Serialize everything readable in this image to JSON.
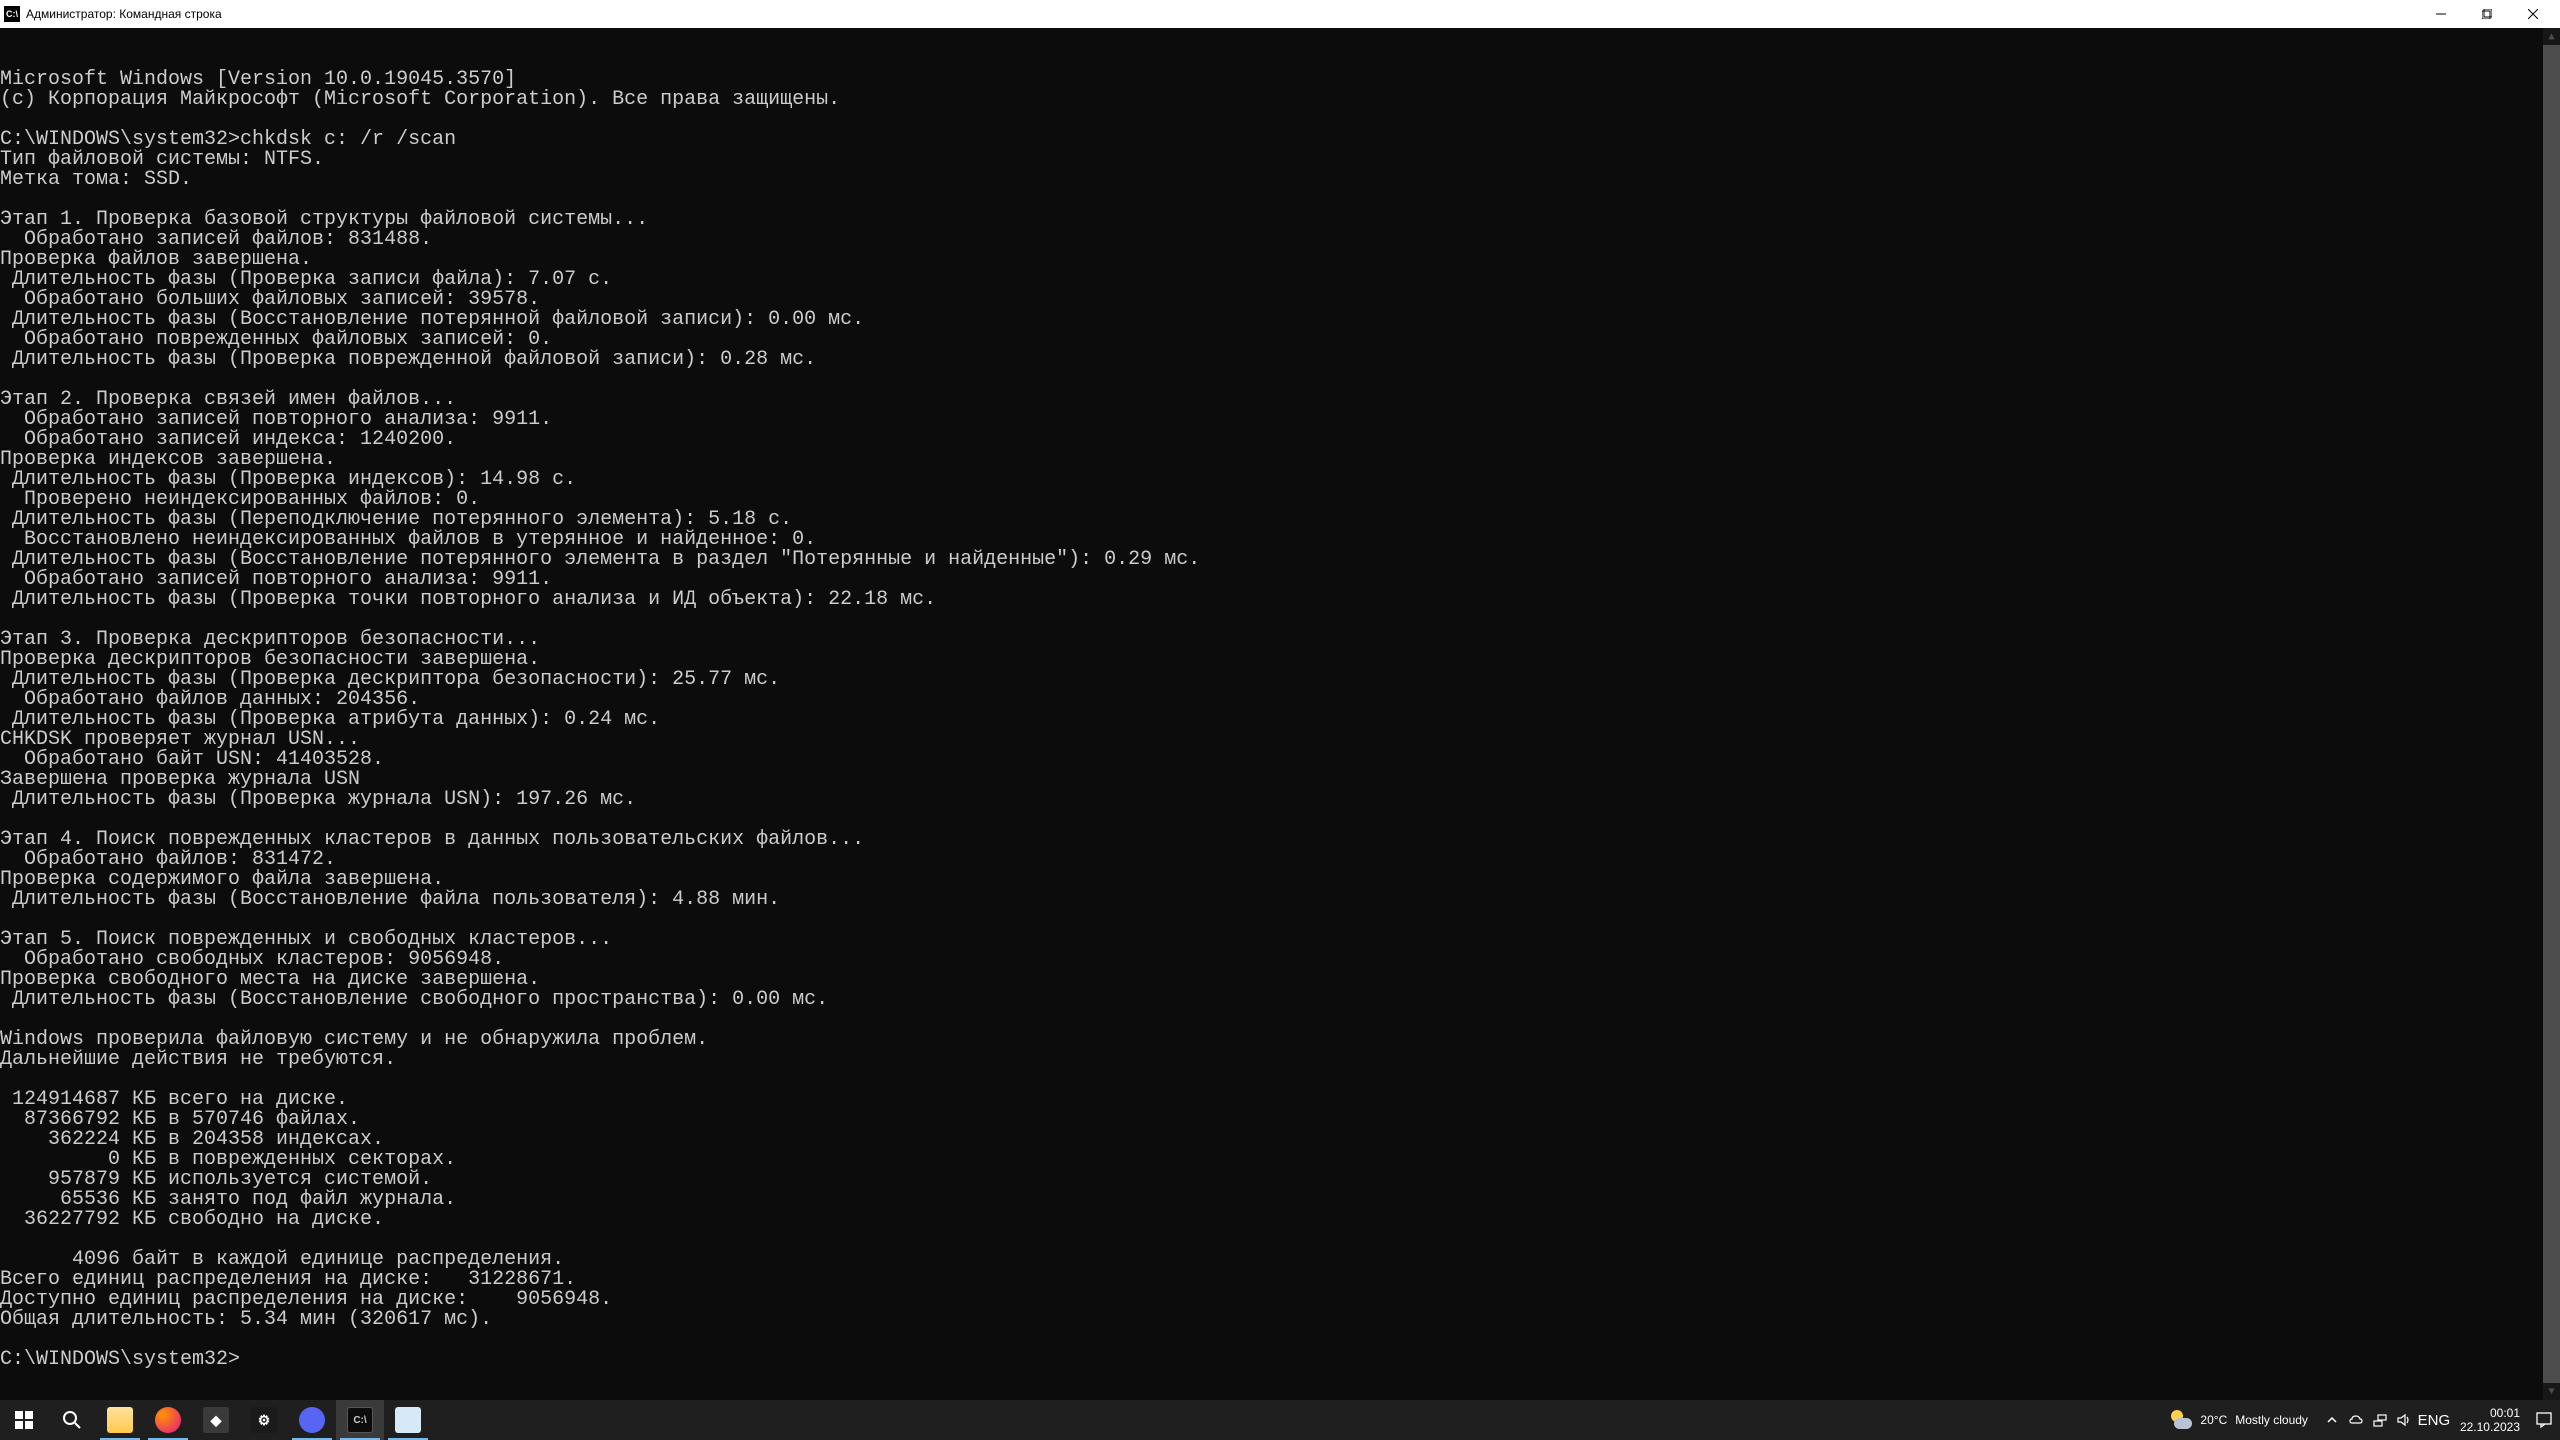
{
  "window": {
    "title": "Администратор: Командная строка"
  },
  "terminal": {
    "lines": "Microsoft Windows [Version 10.0.19045.3570]\n(c) Корпорация Майкрософт (Microsoft Corporation). Все права защищены.\n\nC:\\WINDOWS\\system32>chkdsk c: /r /scan\nТип файловой системы: NTFS.\nМетка тома: SSD.\n\nЭтап 1. Проверка базовой структуры файловой системы...\n  Обработано записей файлов: 831488.\nПроверка файлов завершена.\n Длительность фазы (Проверка записи файла): 7.07 с.\n  Обработано больших файловых записей: 39578.\n Длительность фазы (Восстановление потерянной файловой записи): 0.00 мс.\n  Обработано поврежденных файловых записей: 0.\n Длительность фазы (Проверка поврежденной файловой записи): 0.28 мс.\n\nЭтап 2. Проверка связей имен файлов...\n  Обработано записей повторного анализа: 9911.\n  Обработано записей индекса: 1240200.\nПроверка индексов завершена.\n Длительность фазы (Проверка индексов): 14.98 с.\n  Проверено неиндексированных файлов: 0.\n Длительность фазы (Переподключение потерянного элемента): 5.18 с.\n  Восстановлено неиндексированных файлов в утерянное и найденное: 0.\n Длительность фазы (Восстановление потерянного элемента в раздел \"Потерянные и найденные\"): 0.29 мс.\n  Обработано записей повторного анализа: 9911.\n Длительность фазы (Проверка точки повторного анализа и ИД объекта): 22.18 мс.\n\nЭтап 3. Проверка дескрипторов безопасности...\nПроверка дескрипторов безопасности завершена.\n Длительность фазы (Проверка дескриптора безопасности): 25.77 мс.\n  Обработано файлов данных: 204356.\n Длительность фазы (Проверка атрибута данных): 0.24 мс.\nCHKDSK проверяет журнал USN...\n  Обработано байт USN: 41403528.\nЗавершена проверка журнала USN\n Длительность фазы (Проверка журнала USN): 197.26 мс.\n\nЭтап 4. Поиск поврежденных кластеров в данных пользовательских файлов...\n  Обработано файлов: 831472.\nПроверка содержимого файла завершена.\n Длительность фазы (Восстановление файла пользователя): 4.88 мин.\n\nЭтап 5. Поиск поврежденных и свободных кластеров...\n  Обработано свободных кластеров: 9056948.\nПроверка свободного места на диске завершена.\n Длительность фазы (Восстановление свободного пространства): 0.00 мс.\n\nWindows проверила файловую систему и не обнаружила проблем.\nДальнейшие действия не требуются.\n\n 124914687 КБ всего на диске.\n  87366792 КБ в 570746 файлах.\n    362224 КБ в 204358 индексах.\n         0 КБ в поврежденных секторах.\n    957879 КБ используется системой.\n     65536 КБ занято под файл журнала.\n  36227792 КБ свободно на диске.\n\n      4096 байт в каждой единице распределения.\nВсего единиц распределения на диске:   31228671.\nДоступно единиц распределения на диске:    9056948.\nОбщая длительность: 5.34 мин (320617 мс).\n\nC:\\WINDOWS\\system32>"
  },
  "taskbar": {
    "weather_temp": "20°C",
    "weather_desc": "Mostly cloudy",
    "lang": "ENG",
    "time": "00:01",
    "date": "22.10.2023"
  }
}
